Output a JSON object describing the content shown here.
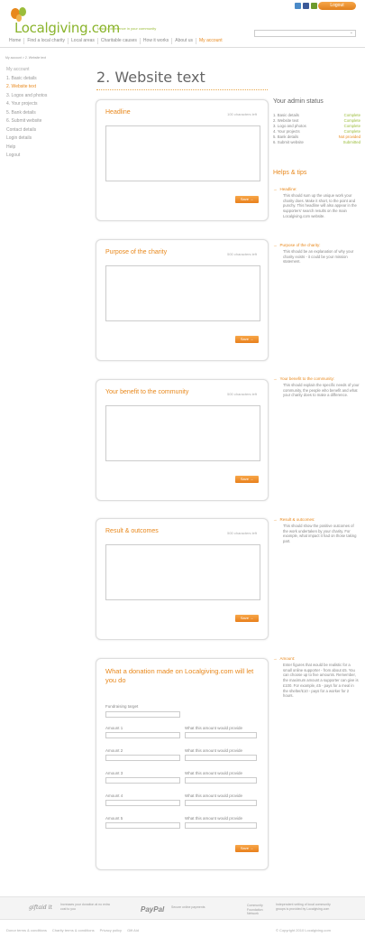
{
  "header": {
    "logo_text": "Localgiving.com",
    "tagline": "Make a difference in your community",
    "logout_label": "Logout",
    "search_arrow": "⌄",
    "social": [
      {
        "name": "twitter",
        "color": "#4a8ac8"
      },
      {
        "name": "facebook",
        "color": "#3b5998"
      },
      {
        "name": "youtube",
        "color": "#6c9a2c"
      }
    ]
  },
  "nav": {
    "items": [
      {
        "label": "Home"
      },
      {
        "label": "Find a local charity"
      },
      {
        "label": "Local areas"
      },
      {
        "label": "Charitable causes"
      },
      {
        "label": "How it works"
      },
      {
        "label": "About us"
      },
      {
        "label": "My account"
      }
    ]
  },
  "breadcrumb": "My account > 2. Website text",
  "sidebar": {
    "items": [
      {
        "label": "My account"
      },
      {
        "label": "1. Basic details"
      },
      {
        "label": "2. Website text"
      },
      {
        "label": "3. Logos and photos"
      },
      {
        "label": "4. Your projects"
      },
      {
        "label": "5. Bank details"
      },
      {
        "label": "6. Submit website"
      },
      {
        "label": "Contact details"
      },
      {
        "label": "Login details"
      },
      {
        "label": "Help"
      },
      {
        "label": "Logout"
      }
    ]
  },
  "page_title": "2. Website text",
  "cards": [
    {
      "title": "Headline",
      "count": "100 characters left",
      "save": "Save →"
    },
    {
      "title": "Purpose of the charity",
      "count": "500 characters left",
      "save": "Save →"
    },
    {
      "title": "Your benefit to the community",
      "count": "500 characters left",
      "save": "Save →"
    },
    {
      "title": "Result & outcomes",
      "count": "500 characters left",
      "save": "Save →"
    }
  ],
  "donation": {
    "title": "What a donation made on Localgiving.com will let you do",
    "fundraising_label": "Fundraising target",
    "amount_labels": [
      "Amount 1",
      "Amount 2",
      "Amount 3",
      "Amount 4",
      "Amount 5"
    ],
    "provide_label": "What this amount would provide",
    "save": "Save →"
  },
  "admin": {
    "title": "Your admin status",
    "rows": [
      {
        "label": "1. Basic details",
        "status": "Complete"
      },
      {
        "label": "2. Website text",
        "status": "Complete"
      },
      {
        "label": "3. Logo and photos",
        "status": "Complete"
      },
      {
        "label": "4. Your projects",
        "status": "Complete"
      },
      {
        "label": "5. Bank details",
        "status": "Not provided"
      },
      {
        "label": "6. Submit website",
        "status": "Submitted"
      }
    ]
  },
  "helps": {
    "title": "Helps & tips",
    "tips": [
      {
        "head": "Headline:",
        "body": "This should sum up the unique work your charity does. Make it short, to the point and punchy. This headline will also appear in the supporters' search results on the main Localgiving.com website."
      },
      {
        "head": "Purpose of the charity:",
        "body": "This should be an explanation of why your charity exists - it could be your mission statement."
      },
      {
        "head": "Your benefit to the community:",
        "body": "This should explain the specific needs of your community, the people who benefit and what your charity does to make a difference."
      },
      {
        "head": "Result & outcomes:",
        "body": "This should show the positive outcomes of the work undertaken by your charity. For example, what impact it had on those taking part."
      },
      {
        "head": "Amount:",
        "body": "Enter figures that would be realistic for a small online supporter - from about £5. You can choose up to five amounts. Remember, the maximum amount a supporter can give is £100. For example, £5 - pays for a meal in the shelter/£10 - pays for a worker for 2 hours."
      }
    ]
  },
  "footer": {
    "giftaid": "giftaid it",
    "giftaid_text": "Increases your donation at no extra cost to you",
    "paypal": "PayPal",
    "paypal_text": "Secure online payments",
    "network_logo": "Community Foundation Network",
    "network_text": "Independent vetting of local community groups is provided by Localgiving.com",
    "links": [
      "Donor terms & conditions",
      "Charity terms & conditions",
      "Privacy policy",
      "Gift Aid"
    ],
    "copyright": "© Copyright 2010 Localgiving.com"
  }
}
